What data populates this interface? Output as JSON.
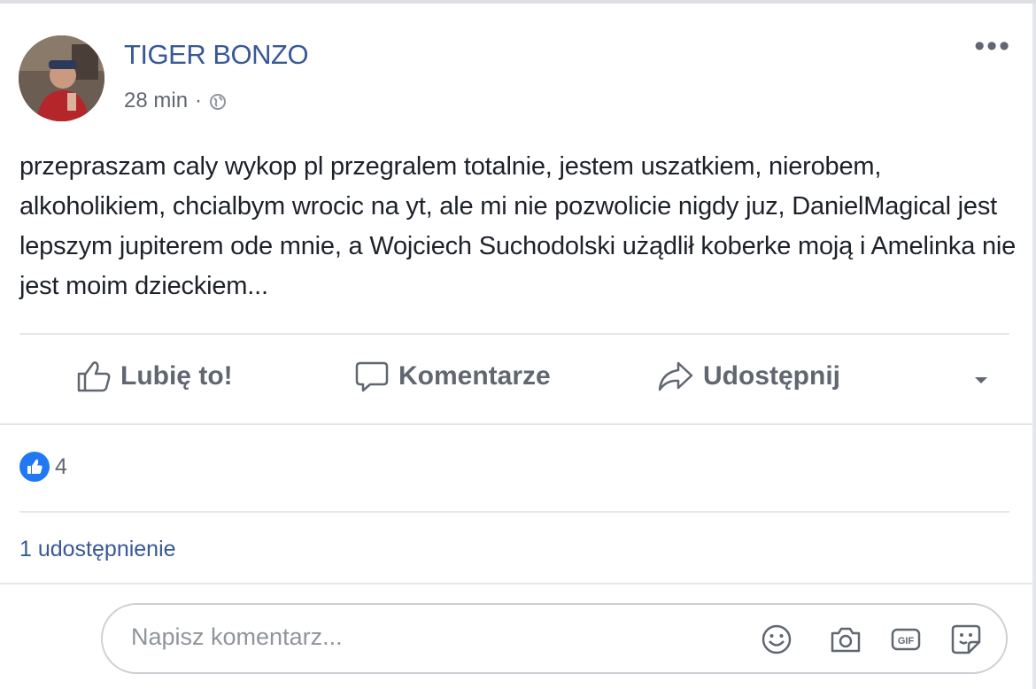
{
  "post": {
    "author": "TIGER BONZO",
    "time": "28 min",
    "separator": "·",
    "text": "przepraszam caly wykop pl przegralem totalnie, jestem uszatkiem, nierobem, alkoholikiem, chcialbym wrocic na yt, ale mi nie pozwolicie nigdy juz, DanielMagical jest lepszym jupiterem ode mnie, a Wojciech Suchodolski użądlił koberke moją i Amelinka nie jest moim dzieckiem...",
    "more_icon": "more-horizontal-icon",
    "privacy_icon": "globe-icon"
  },
  "actions": {
    "like_label": "Lubię to!",
    "comment_label": "Komentarze",
    "share_label": "Udostępnij",
    "dropdown_icon": "chevron-down-icon"
  },
  "reactions": {
    "icon": "like-badge-icon",
    "count": "4"
  },
  "shares": {
    "label": "1 udostępnienie"
  },
  "comment": {
    "placeholder": "Napisz komentarz...",
    "icons": [
      "emoji-icon",
      "camera-icon",
      "gif-icon",
      "sticker-icon"
    ]
  },
  "colors": {
    "link": "#385898",
    "secondary_text": "#606770",
    "divider": "#e4e6eb",
    "like_blue": "#2078f4"
  }
}
